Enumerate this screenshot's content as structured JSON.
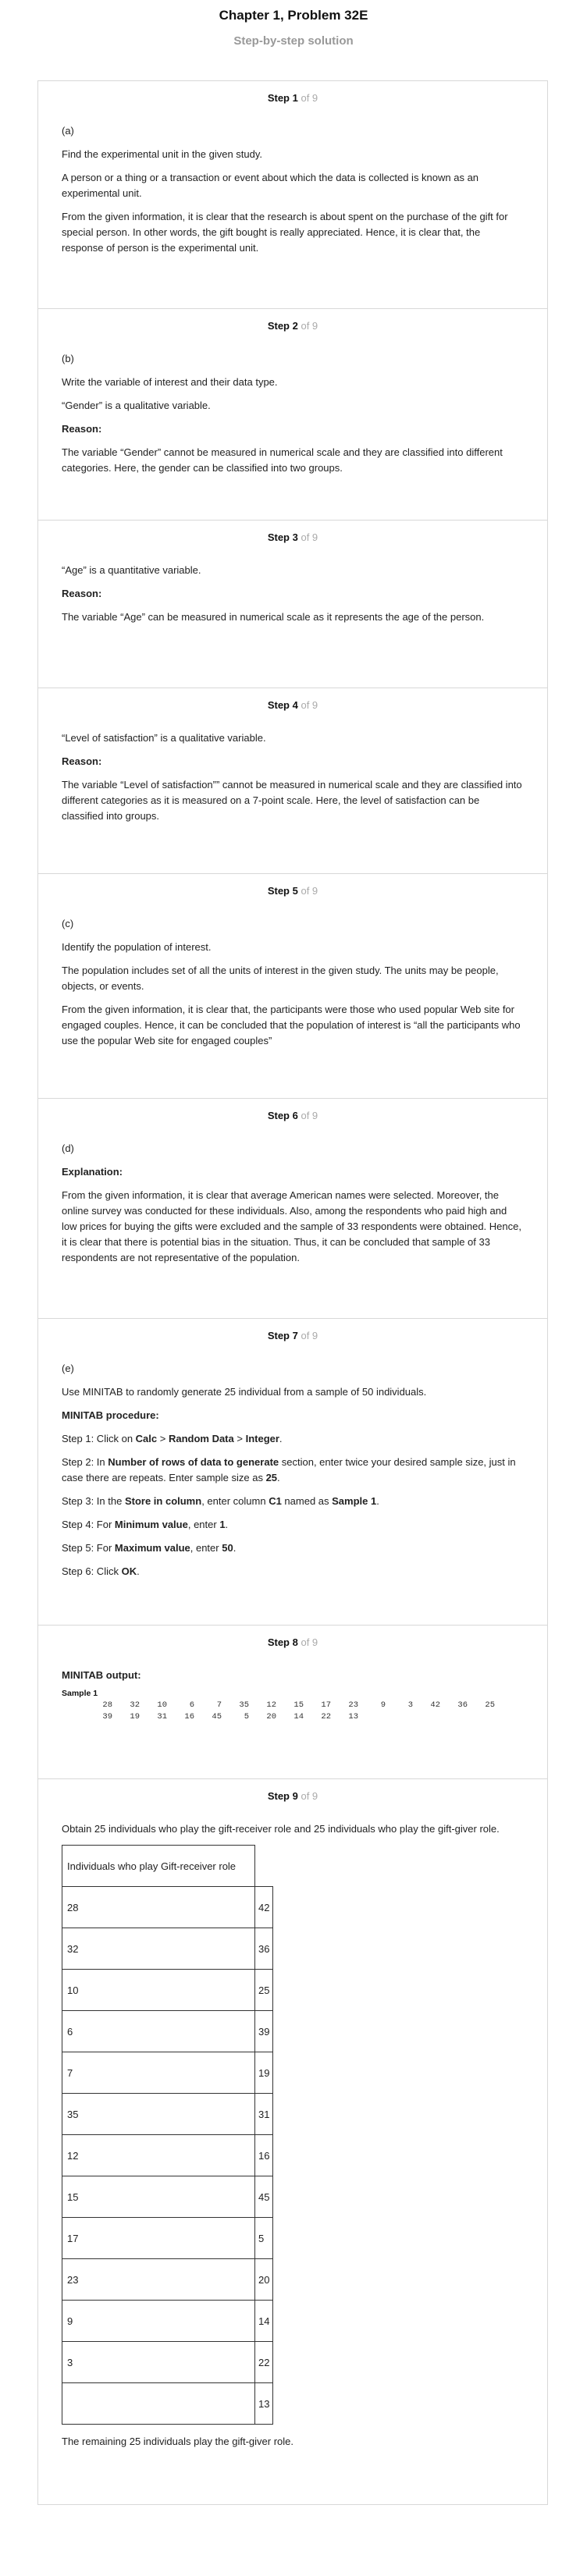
{
  "header": {
    "title": "Chapter 1, Problem 32E",
    "subtitle": "Step-by-step solution"
  },
  "step_labels": {
    "of": "of"
  },
  "steps": [
    {
      "num": "Step 1",
      "total": "of 9",
      "part": "(a)",
      "line1": "Find the experimental unit in the given study.",
      "line2": "A person or a thing or a transaction or event about which the data is collected is known as an experimental unit.",
      "line3": "From the given information, it is clear that the research is about spent on the purchase of the gift for special person. In other words, the gift bought is really appreciated. Hence, it is clear that, the response of person is the experimental unit."
    },
    {
      "num": "Step 2",
      "total": "of 9",
      "part": "(b)",
      "line1": "Write the variable of interest and their data type.",
      "line2": "“Gender” is a qualitative variable.",
      "reason": "Reason:",
      "line3": "The variable “Gender” cannot be measured in numerical scale and they are classified into different categories. Here, the gender can be classified into two groups."
    },
    {
      "num": "Step 3",
      "total": "of 9",
      "line1": "“Age” is a quantitative variable.",
      "reason": "Reason:",
      "line2": "The variable “Age” can be measured in numerical scale as it represents the age of the person."
    },
    {
      "num": "Step 4",
      "total": "of 9",
      "line1": "“Level of satisfaction” is a qualitative variable.",
      "reason": "Reason:",
      "line2": "The variable “Level of satisfaction”” cannot be measured in numerical scale and they are classified into different categories as it is measured on a 7-point scale. Here, the level of satisfaction can be classified into groups."
    },
    {
      "num": "Step 5",
      "total": "of 9",
      "part": "(c)",
      "line1": "Identify the population of interest.",
      "line2": "The population includes set of all the units of interest in the given study. The units may be people, objects, or events.",
      "line3": "From the given information, it is clear that, the participants were those who used popular Web site for engaged couples. Hence, it can be concluded that the population of interest is “all the participants who use the popular Web site for engaged couples”"
    },
    {
      "num": "Step 6",
      "total": "of 9",
      "part": "(d)",
      "explanation": "Explanation:",
      "line1": "From the given information, it is clear that average American names were selected. Moreover, the online survey was conducted for these individuals. Also, among the respondents who paid high and low prices for buying the gifts were excluded and the sample of 33 respondents were obtained. Hence, it is clear that there is potential bias in the situation. Thus, it can be concluded that sample of 33 respondents are not representative of the population."
    },
    {
      "num": "Step 7",
      "total": "of 9",
      "part": "(e)",
      "line1": "Use MINITAB to randomly generate 25 individual from a sample of 50 individuals.",
      "procedure": "MINITAB procedure:",
      "s1_pre": "Step 1: Click on ",
      "s1_b1": "Calc",
      "s1_sep1": " > ",
      "s1_b2": "Random Data",
      "s1_sep2": " > ",
      "s1_b3": "Integer",
      "s1_end": ".",
      "s2_pre": "Step 2: In ",
      "s2_b1": "Number of rows of data to generate",
      "s2_mid": " section, enter twice your desired sample size, just in case there are repeats. Enter sample size as ",
      "s2_b2": "25",
      "s2_end": ".",
      "s3_pre": "Step 3: In the ",
      "s3_b1": "Store in column",
      "s3_mid": ", enter column ",
      "s3_b2": "C1",
      "s3_mid2": " named as ",
      "s3_b3": "Sample 1",
      "s3_end": ".",
      "s4_pre": "Step 4: For ",
      "s4_b1": "Minimum value",
      "s4_mid": ", enter ",
      "s4_b2": "1",
      "s4_end": ".",
      "s5_pre": "Step 5: For ",
      "s5_b1": "Maximum value",
      "s5_mid": ", enter ",
      "s5_b2": "50",
      "s5_end": ".",
      "s6_pre": "Step 6: Click ",
      "s6_b1": "OK",
      "s6_end": "."
    },
    {
      "num": "Step 8",
      "total": "of 9",
      "output": "MINITAB output:",
      "sample_label": "Sample 1",
      "row1": [
        "28",
        "32",
        "10",
        "6",
        "7",
        "35",
        "12",
        "15",
        "17",
        "23",
        "9",
        "3",
        "42",
        "36",
        "25"
      ],
      "row2": [
        "39",
        "19",
        "31",
        "16",
        "45",
        "5",
        "20",
        "14",
        "22",
        "13"
      ]
    },
    {
      "num": "Step 9",
      "total": "of 9",
      "line1": "Obtain 25 individuals who play the gift-receiver role and 25 individuals who play the gift-giver role.",
      "table_header": "Individuals who play Gift-receiver role",
      "table_rows": [
        [
          "28",
          "42"
        ],
        [
          "32",
          "36"
        ],
        [
          "10",
          "25"
        ],
        [
          "6",
          "39"
        ],
        [
          "7",
          "19"
        ],
        [
          "35",
          "31"
        ],
        [
          "12",
          "16"
        ],
        [
          "15",
          "45"
        ],
        [
          "17",
          "5"
        ],
        [
          "23",
          "20"
        ],
        [
          "9",
          "14"
        ],
        [
          "3",
          "22"
        ],
        [
          "",
          "13"
        ]
      ],
      "line2": "The remaining 25 individuals play the gift-giver role."
    }
  ]
}
